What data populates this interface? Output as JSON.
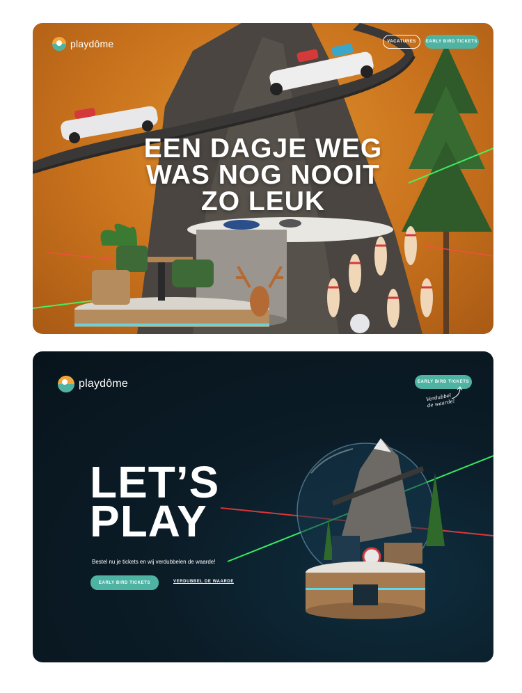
{
  "site1": {
    "brand": "playdôme",
    "nav": {
      "vacatures_label": "VACATURES",
      "tickets_label": "EARLY BIRD TICKETS"
    },
    "hero": {
      "lines": [
        "EEN DAGJE WEG",
        "WAS NOG NOOIT",
        "ZO LEUK"
      ]
    }
  },
  "site2": {
    "brand": "playdôme",
    "nav": {
      "tickets_label": "EARLY BIRD TICKETS"
    },
    "annotation": [
      "Verdubbel",
      "de waarde!"
    ],
    "hero": {
      "lines": [
        "LET’S",
        "PLAY"
      ],
      "subtitle": "Bestel nu je tickets en wij verdubbelen de waarde!",
      "cta_label": "EARLY BIRD TICKETS",
      "link_label": "VERDUBBEL DE WAARDE"
    }
  },
  "colors": {
    "accent_teal": "#4fb3a4",
    "logo_orange": "#f2a63a",
    "card1_bg": "#c9721d",
    "card2_bg": "#0b1c27"
  }
}
